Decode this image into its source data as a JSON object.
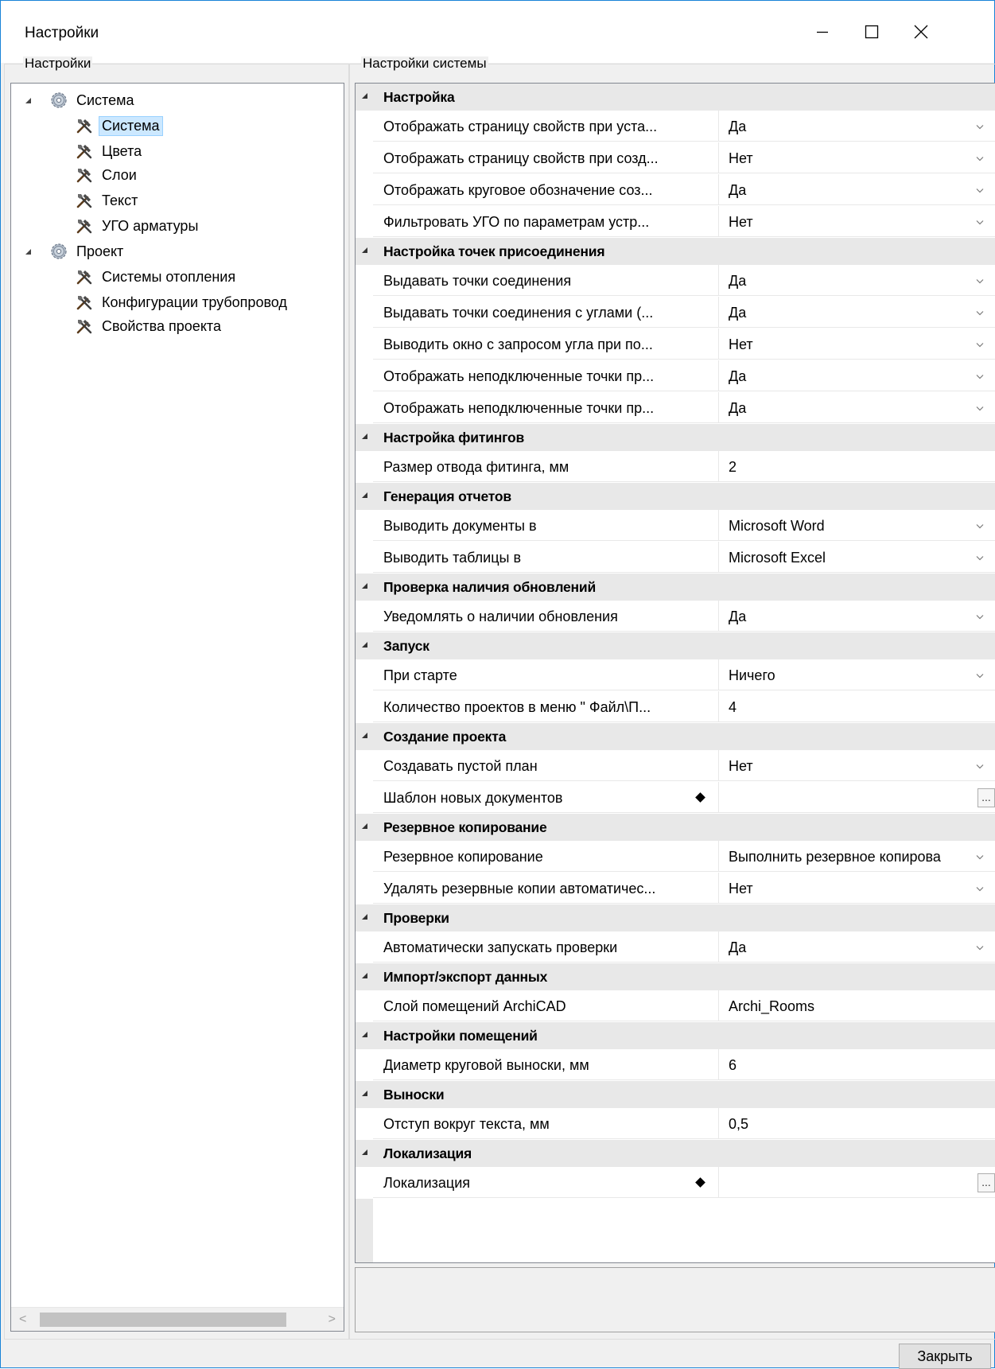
{
  "window": {
    "title": "Настройки",
    "minimize_label": "—",
    "maximize_label": "☐",
    "close_label": "✕"
  },
  "left_group_title": "Настройки",
  "right_group_title": "Настройки системы",
  "tree": [
    {
      "label": "Система",
      "icon": "gear-icon",
      "level": 0,
      "expanded": true
    },
    {
      "label": "Система",
      "icon": "tools-icon",
      "level": 1,
      "selected": true
    },
    {
      "label": "Цвета",
      "icon": "tools-icon",
      "level": 1
    },
    {
      "label": "Слои",
      "icon": "tools-icon",
      "level": 1
    },
    {
      "label": "Текст",
      "icon": "tools-icon",
      "level": 1
    },
    {
      "label": "УГО арматуры",
      "icon": "tools-icon",
      "level": 1
    },
    {
      "label": "Проект",
      "icon": "gear-icon",
      "level": 0,
      "expanded": true
    },
    {
      "label": "Системы отопления",
      "icon": "tools-icon",
      "level": 1
    },
    {
      "label": "Конфигурации трубопровод",
      "icon": "tools-icon",
      "level": 1
    },
    {
      "label": "Свойства проекта",
      "icon": "tools-icon",
      "level": 1
    }
  ],
  "grid": [
    {
      "type": "category",
      "label": "Настройка"
    },
    {
      "type": "property",
      "name": "Отображать страницу свойств при уста...",
      "value": "Да",
      "editor": "dropdown"
    },
    {
      "type": "property",
      "name": "Отображать страницу свойств при созд...",
      "value": "Нет",
      "editor": "dropdown"
    },
    {
      "type": "property",
      "name": "Отображать круговое обозначение соз...",
      "value": "Да",
      "editor": "dropdown"
    },
    {
      "type": "property",
      "name": "Фильтровать УГО по параметрам устр...",
      "value": "Нет",
      "editor": "dropdown"
    },
    {
      "type": "category",
      "label": "Настройка точек присоединения"
    },
    {
      "type": "property",
      "name": "Выдавать точки соединения",
      "value": "Да",
      "editor": "dropdown"
    },
    {
      "type": "property",
      "name": "Выдавать точки соединения с углами (...",
      "value": "Да",
      "editor": "dropdown"
    },
    {
      "type": "property",
      "name": "Выводить окно с запросом угла при по...",
      "value": "Нет",
      "editor": "dropdown"
    },
    {
      "type": "property",
      "name": "Отображать неподключенные точки пр...",
      "value": "Да",
      "editor": "dropdown"
    },
    {
      "type": "property",
      "name": "Отображать неподключенные точки пр...",
      "value": "Да",
      "editor": "dropdown"
    },
    {
      "type": "category",
      "label": "Настройка фитингов"
    },
    {
      "type": "property",
      "name": "Размер отвода фитинга, мм",
      "value": "2",
      "editor": "text"
    },
    {
      "type": "category",
      "label": "Генерация отчетов"
    },
    {
      "type": "property",
      "name": "Выводить документы в",
      "value": "Microsoft Word",
      "editor": "dropdown"
    },
    {
      "type": "property",
      "name": "Выводить таблицы в",
      "value": "Microsoft Excel",
      "editor": "dropdown"
    },
    {
      "type": "category",
      "label": "Проверка наличия обновлений"
    },
    {
      "type": "property",
      "name": "Уведомлять о наличии обновления",
      "value": "Да",
      "editor": "dropdown"
    },
    {
      "type": "category",
      "label": "Запуск"
    },
    {
      "type": "property",
      "name": "При старте",
      "value": "Ничего",
      "editor": "dropdown"
    },
    {
      "type": "property",
      "name": "Количество проектов в меню \" Файл\\П...",
      "value": "4",
      "editor": "text"
    },
    {
      "type": "category",
      "label": "Создание проекта"
    },
    {
      "type": "property",
      "name": "Создавать пустой план",
      "value": "Нет",
      "editor": "dropdown"
    },
    {
      "type": "property",
      "name": "Шаблон новых документов",
      "value": "",
      "editor": "browse",
      "marker": true
    },
    {
      "type": "category",
      "label": "Резервное копирование"
    },
    {
      "type": "property",
      "name": "Резервное копирование",
      "value": "Выполнить резервное копирова",
      "editor": "dropdown"
    },
    {
      "type": "property",
      "name": "Удалять резервные копии автоматичес...",
      "value": "Нет",
      "editor": "dropdown"
    },
    {
      "type": "category",
      "label": "Проверки"
    },
    {
      "type": "property",
      "name": "Автоматически запускать проверки",
      "value": "Да",
      "editor": "dropdown"
    },
    {
      "type": "category",
      "label": "Импорт/экспорт данных"
    },
    {
      "type": "property",
      "name": "Слой помещений ArchiCAD",
      "value": "Archi_Rooms",
      "editor": "text"
    },
    {
      "type": "category",
      "label": "Настройки помещений"
    },
    {
      "type": "property",
      "name": "Диаметр круговой выноски, мм",
      "value": "6",
      "editor": "text"
    },
    {
      "type": "category",
      "label": "Выноски"
    },
    {
      "type": "property",
      "name": "Отступ вокруг текста, мм",
      "value": "0,5",
      "editor": "text"
    },
    {
      "type": "category",
      "label": "Локализация"
    },
    {
      "type": "property",
      "name": "Локализация",
      "value": "",
      "editor": "browse",
      "marker": true
    }
  ],
  "browse_button_label": "...",
  "close_button_label": "Закрыть"
}
